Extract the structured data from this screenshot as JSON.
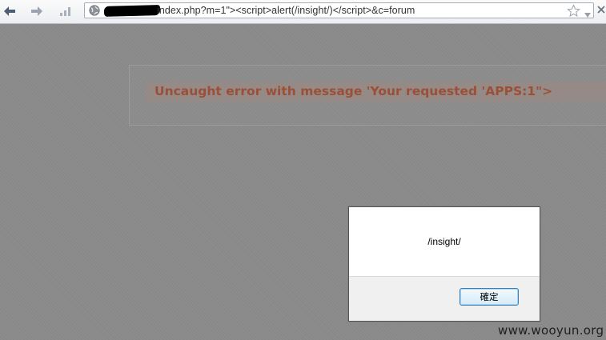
{
  "browser": {
    "url": "index.php?m=1\"><script>alert(/insight/)</script>&c=forum",
    "icons": {
      "back": "back-arrow-icon",
      "forward": "forward-arrow-icon",
      "stats": "signal-bars-icon",
      "site": "globe-icon",
      "bookmark": "star-icon",
      "menu": "dropdown-triangle-icon",
      "close": "close-icon"
    }
  },
  "page": {
    "error_message": "Uncaught error with message 'Your requested 'APPS:1\">"
  },
  "alert_dialog": {
    "message": "/insight/",
    "ok_label": "確定"
  },
  "watermark": "www.wooyun.org",
  "colors": {
    "error_text": "#9b4f37",
    "overlay_gray": "#8c8c8c",
    "button_border": "#3c7fb1"
  }
}
